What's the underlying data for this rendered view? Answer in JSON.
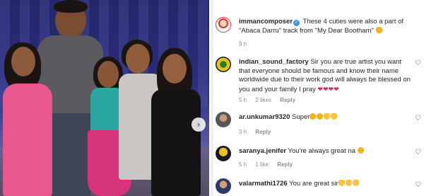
{
  "photo": {
    "next_icon": "›"
  },
  "caption": {
    "username": "immancomposer",
    "text": "These 4 cuties were also a part of \"Abaca Darru\" track from \"My Dear Bootham\"",
    "time": "9 h"
  },
  "comments": [
    {
      "username": "indian_sound_factory",
      "text": "Sir you are true artist you want that everyone should be famous and know their name worldwide due to their work god will always be blessed on you and your family I pray",
      "emojis": "❤❤❤❤",
      "time": "5 h",
      "likes": "2 likes",
      "reply": "Reply"
    },
    {
      "username": "ar.unkumar9320",
      "text": "Super",
      "time": "3 h",
      "reply": "Reply"
    },
    {
      "username": "saranya.jenifer",
      "text": "You're always great na",
      "time": "5 h",
      "likes": "1 like",
      "reply": "Reply"
    },
    {
      "username": "valarmathi1726",
      "text": "You are great sir",
      "time": "",
      "reply": ""
    }
  ],
  "icons": {
    "heart": "♡"
  }
}
